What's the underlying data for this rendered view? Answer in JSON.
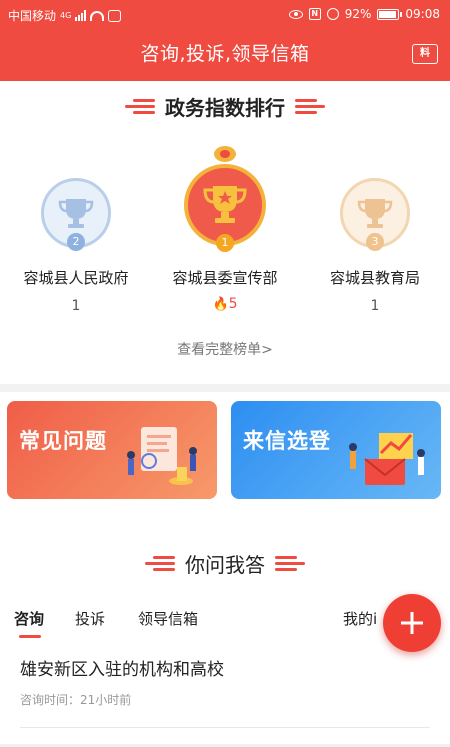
{
  "status_bar": {
    "carrier": "中国移动",
    "network": "4G",
    "battery": "92%",
    "battery_level": 0.92,
    "time": "09:08"
  },
  "header": {
    "title": "咨询,投诉,领导信箱",
    "right_icon_text": "料",
    "bg_color": "#ef4b40"
  },
  "ranking": {
    "title": "政务指数排行",
    "items": [
      {
        "rank": "2",
        "name": "容城县人民政府",
        "score": "1"
      },
      {
        "rank": "1",
        "name": "容城县委宣传部",
        "score": "5",
        "hot_icon": "flame-icon"
      },
      {
        "rank": "3",
        "name": "容城县教育局",
        "score": "1"
      }
    ],
    "more_link": "查看完整榜单>"
  },
  "cards": {
    "faq": {
      "label": "常见问题",
      "color": "#f06b52"
    },
    "letters": {
      "label": "来信选登",
      "color": "#3a96f2"
    }
  },
  "qa": {
    "title": "你问我答",
    "tabs": [
      "咨询",
      "投诉",
      "领导信箱",
      "我的i"
    ],
    "active_tab": "咨询",
    "items": [
      {
        "title": "雄安新区入驻的机构和高校",
        "meta": "咨询时间：21小时前"
      }
    ]
  }
}
